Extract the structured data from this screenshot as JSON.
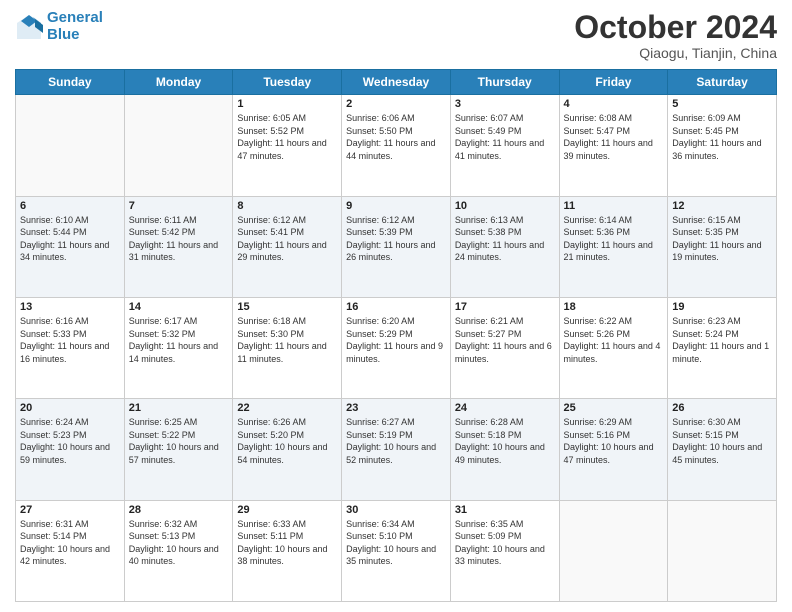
{
  "header": {
    "logo_line1": "General",
    "logo_line2": "Blue",
    "month": "October 2024",
    "location": "Qiaogu, Tianjin, China"
  },
  "days_of_week": [
    "Sunday",
    "Monday",
    "Tuesday",
    "Wednesday",
    "Thursday",
    "Friday",
    "Saturday"
  ],
  "weeks": [
    [
      {
        "day": "",
        "info": ""
      },
      {
        "day": "",
        "info": ""
      },
      {
        "day": "1",
        "info": "Sunrise: 6:05 AM\nSunset: 5:52 PM\nDaylight: 11 hours and 47 minutes."
      },
      {
        "day": "2",
        "info": "Sunrise: 6:06 AM\nSunset: 5:50 PM\nDaylight: 11 hours and 44 minutes."
      },
      {
        "day": "3",
        "info": "Sunrise: 6:07 AM\nSunset: 5:49 PM\nDaylight: 11 hours and 41 minutes."
      },
      {
        "day": "4",
        "info": "Sunrise: 6:08 AM\nSunset: 5:47 PM\nDaylight: 11 hours and 39 minutes."
      },
      {
        "day": "5",
        "info": "Sunrise: 6:09 AM\nSunset: 5:45 PM\nDaylight: 11 hours and 36 minutes."
      }
    ],
    [
      {
        "day": "6",
        "info": "Sunrise: 6:10 AM\nSunset: 5:44 PM\nDaylight: 11 hours and 34 minutes."
      },
      {
        "day": "7",
        "info": "Sunrise: 6:11 AM\nSunset: 5:42 PM\nDaylight: 11 hours and 31 minutes."
      },
      {
        "day": "8",
        "info": "Sunrise: 6:12 AM\nSunset: 5:41 PM\nDaylight: 11 hours and 29 minutes."
      },
      {
        "day": "9",
        "info": "Sunrise: 6:12 AM\nSunset: 5:39 PM\nDaylight: 11 hours and 26 minutes."
      },
      {
        "day": "10",
        "info": "Sunrise: 6:13 AM\nSunset: 5:38 PM\nDaylight: 11 hours and 24 minutes."
      },
      {
        "day": "11",
        "info": "Sunrise: 6:14 AM\nSunset: 5:36 PM\nDaylight: 11 hours and 21 minutes."
      },
      {
        "day": "12",
        "info": "Sunrise: 6:15 AM\nSunset: 5:35 PM\nDaylight: 11 hours and 19 minutes."
      }
    ],
    [
      {
        "day": "13",
        "info": "Sunrise: 6:16 AM\nSunset: 5:33 PM\nDaylight: 11 hours and 16 minutes."
      },
      {
        "day": "14",
        "info": "Sunrise: 6:17 AM\nSunset: 5:32 PM\nDaylight: 11 hours and 14 minutes."
      },
      {
        "day": "15",
        "info": "Sunrise: 6:18 AM\nSunset: 5:30 PM\nDaylight: 11 hours and 11 minutes."
      },
      {
        "day": "16",
        "info": "Sunrise: 6:20 AM\nSunset: 5:29 PM\nDaylight: 11 hours and 9 minutes."
      },
      {
        "day": "17",
        "info": "Sunrise: 6:21 AM\nSunset: 5:27 PM\nDaylight: 11 hours and 6 minutes."
      },
      {
        "day": "18",
        "info": "Sunrise: 6:22 AM\nSunset: 5:26 PM\nDaylight: 11 hours and 4 minutes."
      },
      {
        "day": "19",
        "info": "Sunrise: 6:23 AM\nSunset: 5:24 PM\nDaylight: 11 hours and 1 minute."
      }
    ],
    [
      {
        "day": "20",
        "info": "Sunrise: 6:24 AM\nSunset: 5:23 PM\nDaylight: 10 hours and 59 minutes."
      },
      {
        "day": "21",
        "info": "Sunrise: 6:25 AM\nSunset: 5:22 PM\nDaylight: 10 hours and 57 minutes."
      },
      {
        "day": "22",
        "info": "Sunrise: 6:26 AM\nSunset: 5:20 PM\nDaylight: 10 hours and 54 minutes."
      },
      {
        "day": "23",
        "info": "Sunrise: 6:27 AM\nSunset: 5:19 PM\nDaylight: 10 hours and 52 minutes."
      },
      {
        "day": "24",
        "info": "Sunrise: 6:28 AM\nSunset: 5:18 PM\nDaylight: 10 hours and 49 minutes."
      },
      {
        "day": "25",
        "info": "Sunrise: 6:29 AM\nSunset: 5:16 PM\nDaylight: 10 hours and 47 minutes."
      },
      {
        "day": "26",
        "info": "Sunrise: 6:30 AM\nSunset: 5:15 PM\nDaylight: 10 hours and 45 minutes."
      }
    ],
    [
      {
        "day": "27",
        "info": "Sunrise: 6:31 AM\nSunset: 5:14 PM\nDaylight: 10 hours and 42 minutes."
      },
      {
        "day": "28",
        "info": "Sunrise: 6:32 AM\nSunset: 5:13 PM\nDaylight: 10 hours and 40 minutes."
      },
      {
        "day": "29",
        "info": "Sunrise: 6:33 AM\nSunset: 5:11 PM\nDaylight: 10 hours and 38 minutes."
      },
      {
        "day": "30",
        "info": "Sunrise: 6:34 AM\nSunset: 5:10 PM\nDaylight: 10 hours and 35 minutes."
      },
      {
        "day": "31",
        "info": "Sunrise: 6:35 AM\nSunset: 5:09 PM\nDaylight: 10 hours and 33 minutes."
      },
      {
        "day": "",
        "info": ""
      },
      {
        "day": "",
        "info": ""
      }
    ]
  ]
}
